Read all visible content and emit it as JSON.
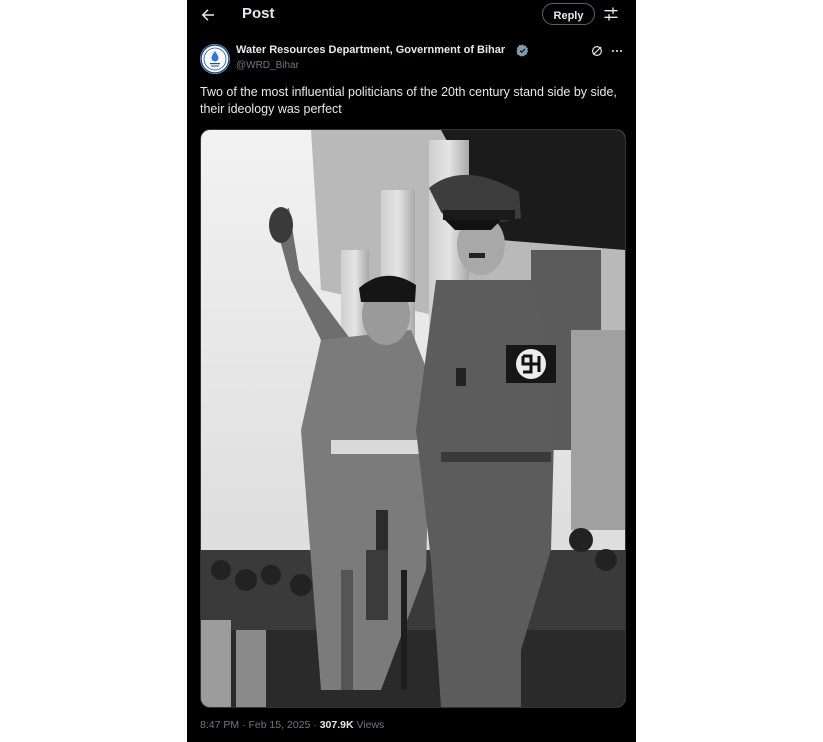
{
  "header": {
    "title": "Post",
    "reply_label": "Reply"
  },
  "author": {
    "name": "Water Resources Department, Government of Bihar",
    "handle": "@WRD_Bihar",
    "verified_color": "#829aab"
  },
  "post": {
    "text": "Two of the most influential politicians of the 20th century stand side by side, their ideology was perfect"
  },
  "meta": {
    "time": "8:47 PM",
    "separator": "·",
    "date": "Feb 15, 2025",
    "views_count": "307.9K",
    "views_label": "Views"
  },
  "colors": {
    "background": "#000000",
    "text_primary": "#e7e9ea",
    "text_secondary": "#71767b",
    "border": "#2f3336"
  },
  "icons": [
    "back-arrow-icon",
    "settings-icon",
    "verified-badge-icon",
    "grok-icon",
    "more-icon"
  ]
}
